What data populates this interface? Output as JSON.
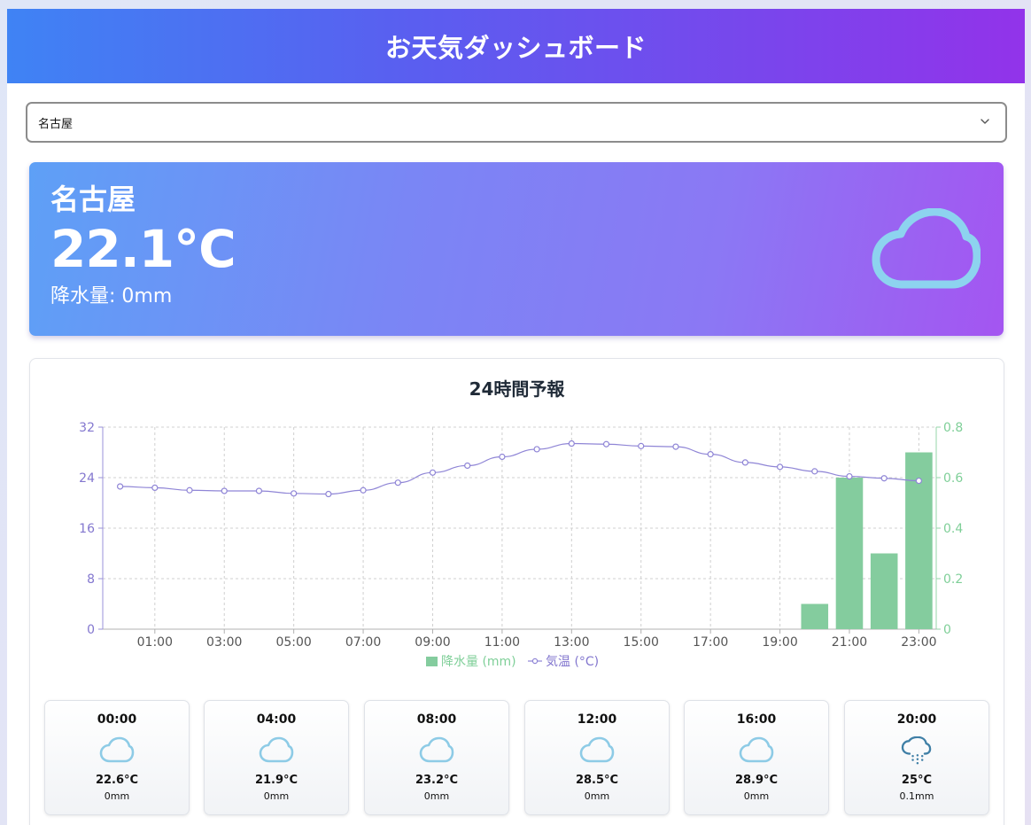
{
  "header": {
    "title": "お天気ダッシュボード"
  },
  "city_select": {
    "value": "名古屋"
  },
  "current": {
    "city": "名古屋",
    "temperature": "22.1°C",
    "precipitation": "降水量: 0mm",
    "icon": "cloud-icon"
  },
  "chart_title": "24時間予報",
  "chart_data": {
    "type": "bar+line",
    "x": [
      "00:00",
      "01:00",
      "02:00",
      "03:00",
      "04:00",
      "05:00",
      "06:00",
      "07:00",
      "08:00",
      "09:00",
      "10:00",
      "11:00",
      "12:00",
      "13:00",
      "14:00",
      "15:00",
      "16:00",
      "17:00",
      "18:00",
      "19:00",
      "20:00",
      "21:00",
      "22:00",
      "23:00"
    ],
    "x_tick_labels": [
      "01:00",
      "03:00",
      "05:00",
      "07:00",
      "09:00",
      "11:00",
      "13:00",
      "15:00",
      "17:00",
      "19:00",
      "21:00",
      "23:00"
    ],
    "series": [
      {
        "name": "降水量 (mm)",
        "type": "bar",
        "axis": "right",
        "values": [
          0,
          0,
          0,
          0,
          0,
          0,
          0,
          0,
          0,
          0,
          0,
          0,
          0,
          0,
          0,
          0,
          0,
          0,
          0,
          0,
          0.1,
          0.6,
          0.3,
          0.7
        ]
      },
      {
        "name": "気温 (°C)",
        "type": "line",
        "axis": "left",
        "values": [
          22.6,
          22.4,
          22.0,
          21.9,
          21.9,
          21.5,
          21.4,
          22.0,
          23.2,
          24.8,
          25.9,
          27.3,
          28.5,
          29.4,
          29.3,
          29.0,
          28.9,
          27.7,
          26.4,
          25.7,
          25.0,
          24.2,
          23.9,
          23.5
        ]
      }
    ],
    "y_left": {
      "min": 0,
      "max": 32,
      "ticks": [
        "0",
        "8",
        "16",
        "24",
        "32"
      ]
    },
    "y_right": {
      "min": 0,
      "max": 0.8,
      "ticks": [
        "0",
        "0.2",
        "0.4",
        "0.6",
        "0.8"
      ]
    },
    "grid": true,
    "legend_position": "bottom",
    "colors": {
      "rain": "#84cc9e",
      "temp": "#8f85d6"
    }
  },
  "hourly": [
    {
      "time": "00:00",
      "temp": "22.6°C",
      "rain": "0mm",
      "icon": "cloud-icon"
    },
    {
      "time": "04:00",
      "temp": "21.9°C",
      "rain": "0mm",
      "icon": "cloud-icon"
    },
    {
      "time": "08:00",
      "temp": "23.2°C",
      "rain": "0mm",
      "icon": "cloud-icon"
    },
    {
      "time": "12:00",
      "temp": "28.5°C",
      "rain": "0mm",
      "icon": "cloud-icon"
    },
    {
      "time": "16:00",
      "temp": "28.9°C",
      "rain": "0mm",
      "icon": "cloud-icon"
    },
    {
      "time": "20:00",
      "temp": "25°C",
      "rain": "0.1mm",
      "icon": "rain-cloud-icon"
    }
  ]
}
